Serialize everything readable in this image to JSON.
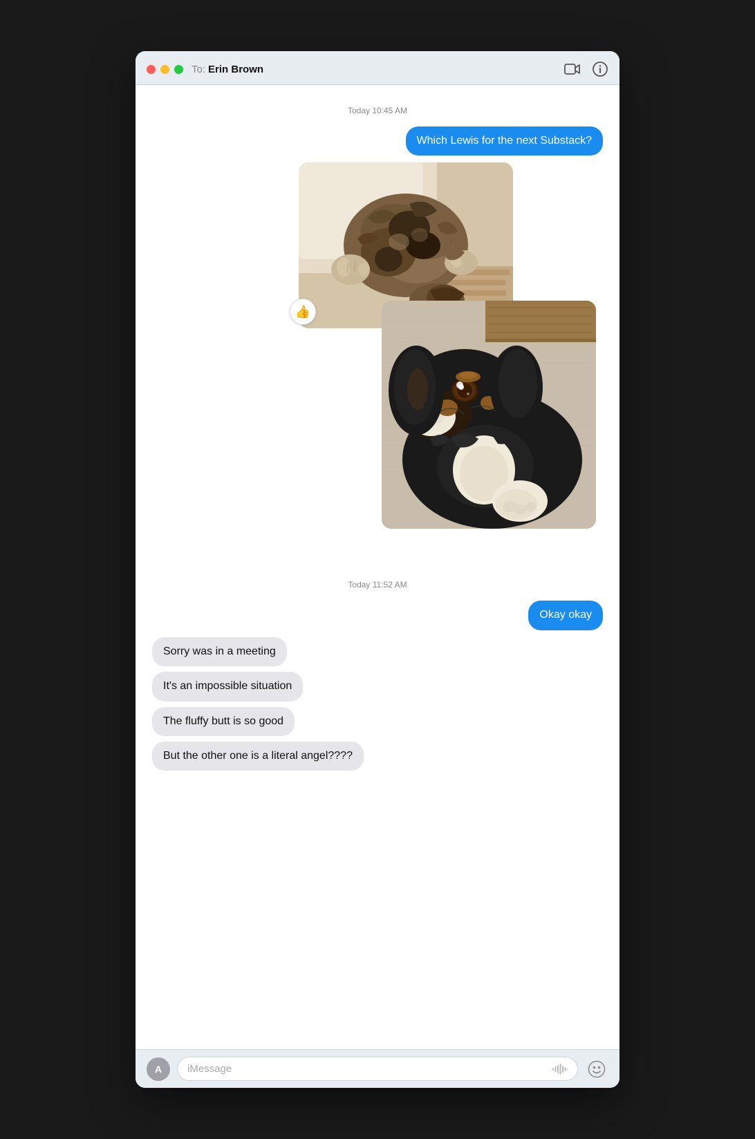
{
  "window": {
    "title": "iMessage"
  },
  "titlebar": {
    "to_label": "To:",
    "recipient_name": "Erin Brown",
    "video_icon": "video-camera",
    "info_icon": "info-circle"
  },
  "messages": [
    {
      "id": "ts1",
      "type": "timestamp",
      "text": "Today 10:45 AM"
    },
    {
      "id": "msg1",
      "type": "sent",
      "text": "Which Lewis for the next Substack?"
    },
    {
      "id": "img1",
      "type": "images"
    },
    {
      "id": "ts2",
      "type": "timestamp",
      "text": "Today 11:52 AM"
    },
    {
      "id": "msg2",
      "type": "sent",
      "text": "Okay okay"
    },
    {
      "id": "msg3",
      "type": "received",
      "text": "Sorry was in a meeting"
    },
    {
      "id": "msg4",
      "type": "received",
      "text": "It's an impossible situation"
    },
    {
      "id": "msg5",
      "type": "received",
      "text": "The fluffy butt is so good"
    },
    {
      "id": "msg6",
      "type": "received",
      "text": "But the other one is a literal angel????"
    }
  ],
  "input_bar": {
    "placeholder": "iMessage",
    "app_icon_label": "A"
  },
  "reaction": {
    "icon": "👍"
  }
}
